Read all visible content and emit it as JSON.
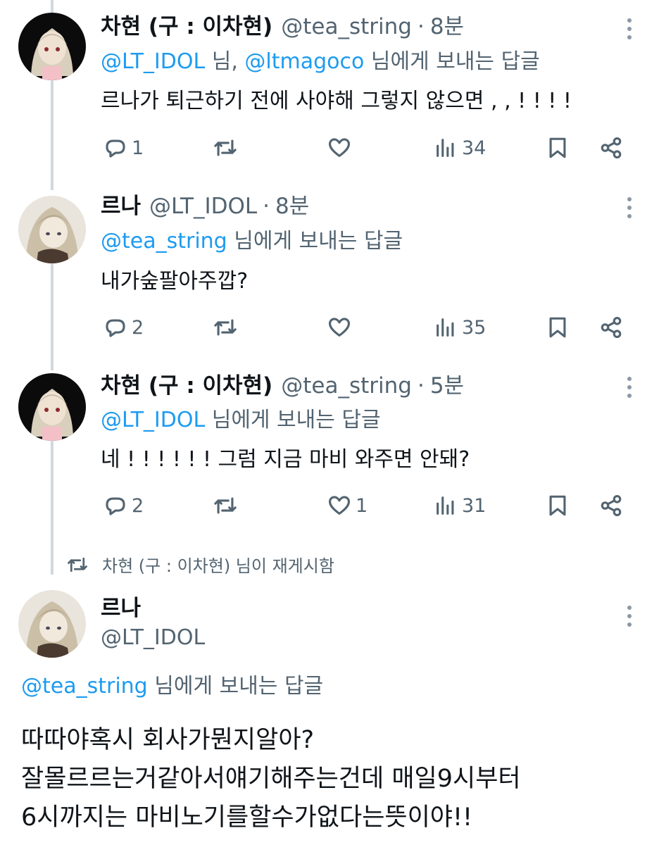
{
  "tweets": [
    {
      "name": "차현 (구 : 이차현)",
      "handle": "@tea_string",
      "dot": "·",
      "time": "8분",
      "reply_mentions": [
        "@LT_IDOL",
        "@ltmagoco"
      ],
      "reply_sep": " 님, ",
      "reply_suffix": " 님에게 보내는 답글",
      "text": "르나가 퇴근하기 전에 사야해 그렇지 않으면 , , ! ! ! !",
      "replies": "1",
      "retweets": "",
      "likes": "",
      "views": "34"
    },
    {
      "name": "르나",
      "handle": "@LT_IDOL",
      "dot": "·",
      "time": "8분",
      "reply_mentions": [
        "@tea_string"
      ],
      "reply_suffix": " 님에게 보내는 답글",
      "text": "내가숲팔아주깝?",
      "replies": "2",
      "retweets": "",
      "likes": "",
      "views": "35"
    },
    {
      "name": "차현 (구 : 이차현)",
      "handle": "@tea_string",
      "dot": "·",
      "time": "5분",
      "reply_mentions": [
        "@LT_IDOL"
      ],
      "reply_suffix": " 님에게 보내는 답글",
      "text": "네 ! ! ! ! ! ! 그럼 지금 마비 와주면 안돼?",
      "replies": "2",
      "retweets": "",
      "likes": "1",
      "views": "31"
    }
  ],
  "retweet_context": "차현 (구 : 이차현) 님이 재게시함",
  "main_tweet": {
    "name": "르나",
    "handle": "@LT_IDOL",
    "reply_mention": "@tea_string",
    "reply_suffix": " 님에게 보내는 답글",
    "lines": [
      "따따야혹시 회사가뭔지알아?",
      "잘몰르르는거같아서얘기해주는건데 매일9시부터",
      "6시까지는 마비노기를할수가없다는뜻이야!!"
    ]
  },
  "icons": {
    "reply": "reply-icon",
    "retweet": "retweet-icon",
    "like": "like-icon",
    "views": "views-icon",
    "bookmark": "bookmark-icon",
    "share": "share-icon",
    "more": "more-vertical-icon"
  },
  "colors": {
    "link": "#1d9bf0",
    "secondary": "#536471",
    "thread_line": "#cfd9de"
  }
}
